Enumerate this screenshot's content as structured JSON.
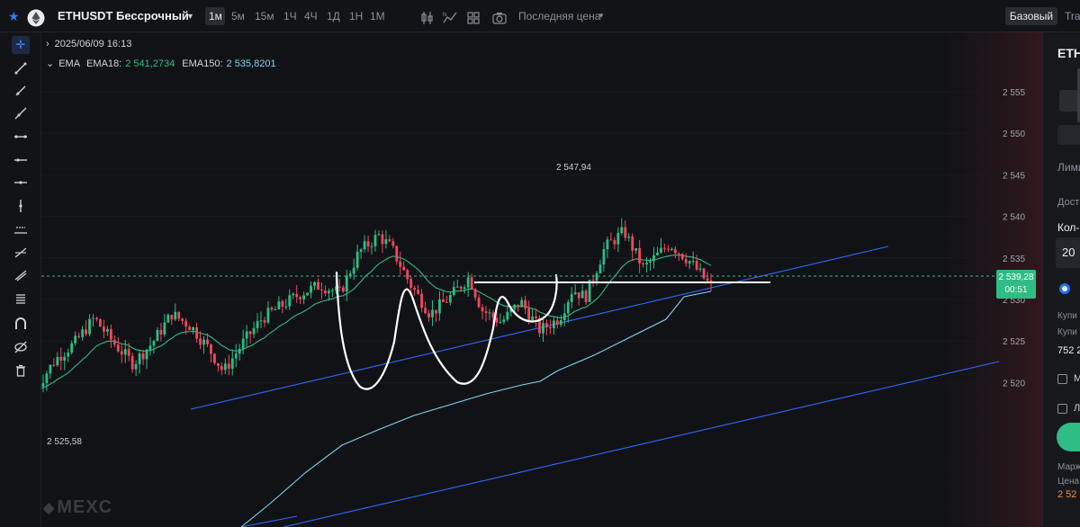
{
  "header": {
    "symbol": "ETHUSDT Бессрочный",
    "timeframes": [
      "1м",
      "5м",
      "15м",
      "1Ч",
      "4Ч",
      "1Д",
      "1Н",
      "1М"
    ],
    "active_timeframe": "1м",
    "price_type": "Последняя цена",
    "mode_tabs": [
      "Базовый",
      "Tra"
    ],
    "active_mode": "Базовый"
  },
  "legend": {
    "datetime": "2025/06/09 16:13",
    "indicator": "EMA",
    "ema18_label": "EMA18:",
    "ema18_value": "2 541,2734",
    "ema150_label": "EMA150:",
    "ema150_value": "2 535,8201"
  },
  "price_axis": {
    "ticks": [
      "2 555",
      "2 550",
      "2 545",
      "2 540",
      "2 535",
      "2 530",
      "2 525",
      "2 520"
    ],
    "current_price": "2 539,28",
    "countdown": "00:51"
  },
  "annotations": {
    "high_label": "2 547,94",
    "low_label": "2 525,58"
  },
  "watermark": "MEXC",
  "right_panel": {
    "title": "ETH",
    "items": [
      "Лими",
      "Дост",
      "Кол-в",
      "20",
      "Купи",
      "Купи",
      "752 2",
      "М",
      "Л",
      "Марж",
      "Цена",
      "2 52"
    ]
  },
  "colors": {
    "up": "#2ebd85",
    "down": "#f6465d",
    "ema18": "#2ebd85",
    "ema150": "#7fd3f0",
    "trendline": "#2f6bff",
    "current_price": "#2ebd85",
    "accent": "#1f6fff"
  }
}
